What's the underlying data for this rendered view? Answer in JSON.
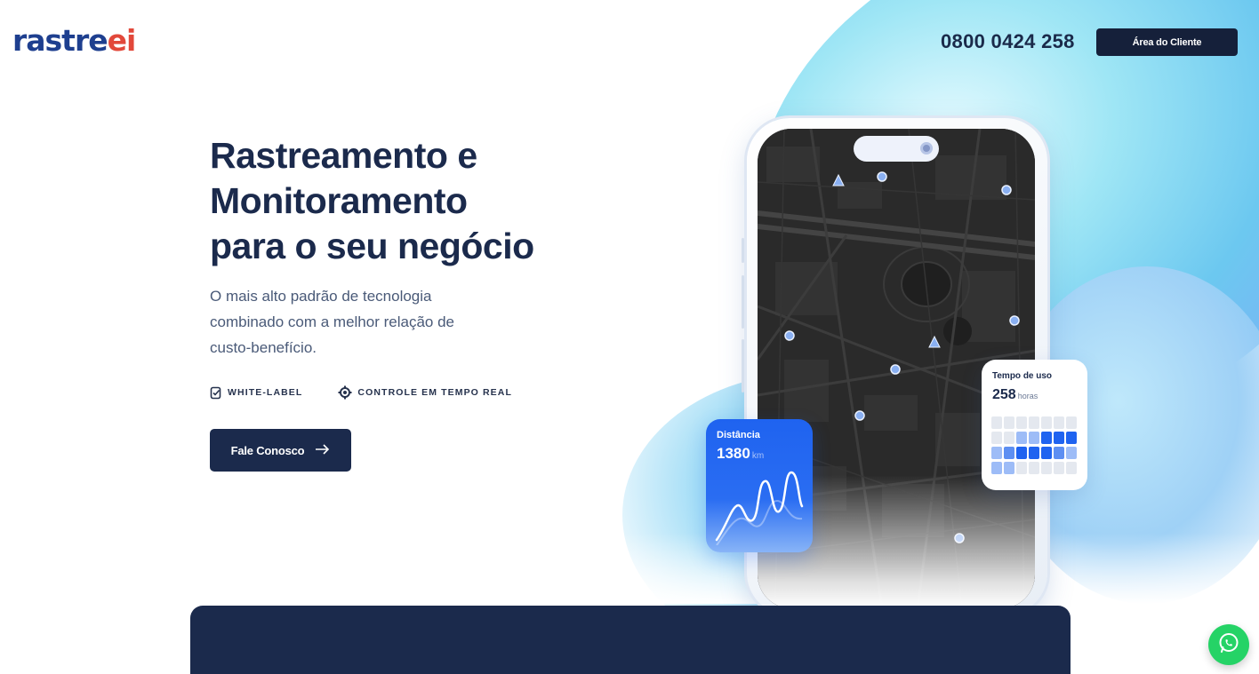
{
  "header": {
    "logo_main": "rastre",
    "logo_accent": "ei",
    "phone": "0800 0424 258",
    "client_area_label": "Área do Cliente"
  },
  "hero": {
    "title_lines": [
      "Rastreamento e",
      "Monitoramento",
      "para o seu negócio"
    ],
    "subtitle_lines": [
      "O mais alto padrão de tecnologia",
      "combinado com a melhor relação de",
      "custo-benefício."
    ],
    "features": [
      {
        "icon": "checklist-icon",
        "label": "WHITE-LABEL"
      },
      {
        "icon": "gear-icon",
        "label": "CONTROLE EM TEMPO REAL"
      }
    ],
    "cta_label": "Fale Conosco",
    "cta_icon": "arrow-right-icon"
  },
  "cards": {
    "distance": {
      "label": "Distância",
      "value": "1380",
      "unit": "km"
    },
    "usage": {
      "label": "Tempo de uso",
      "value": "258",
      "unit": "horas",
      "grid_levels": [
        [
          0,
          0,
          0,
          0,
          0,
          0,
          0
        ],
        [
          0,
          0,
          1,
          1,
          3,
          3,
          3
        ],
        [
          1,
          2,
          3,
          3,
          3,
          2,
          1
        ],
        [
          1,
          1,
          0,
          0,
          0,
          0,
          0
        ]
      ]
    }
  },
  "colors": {
    "brand_navy": "#1b2a4c",
    "brand_blue": "#1e3f8f",
    "brand_red": "#e2483a",
    "accent_blue": "#1f63f0",
    "whatsapp_green": "#25d366"
  }
}
